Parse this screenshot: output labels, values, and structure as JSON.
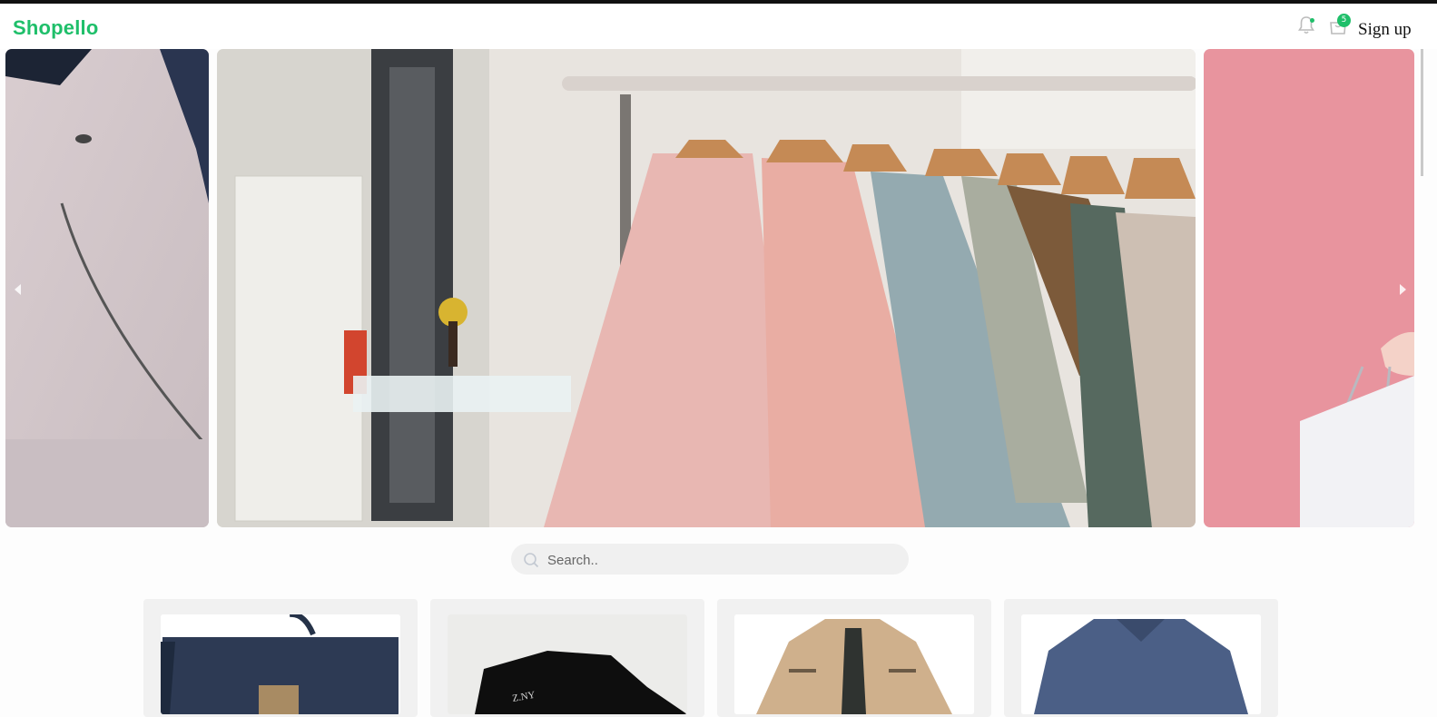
{
  "header": {
    "logo": "Shopello",
    "cart_count": "5",
    "signup_label": "Sign up"
  },
  "icons": {
    "bell": "bell-icon",
    "cart": "cart-icon",
    "search": "search-icon",
    "prev": "chevron-left-icon",
    "next": "chevron-right-icon"
  },
  "carousel": {
    "slides": [
      "coat-closeup",
      "clothing-rack",
      "shopping-bag-pink"
    ]
  },
  "search": {
    "placeholder": "Search.."
  },
  "products": [
    {
      "image": "navy-backpack"
    },
    {
      "image": "black-tshirt"
    },
    {
      "image": "khaki-jacket"
    },
    {
      "image": "blue-sweater"
    }
  ],
  "colors": {
    "brand": "#1fbf6a",
    "pink_bg": "#e8949e"
  }
}
